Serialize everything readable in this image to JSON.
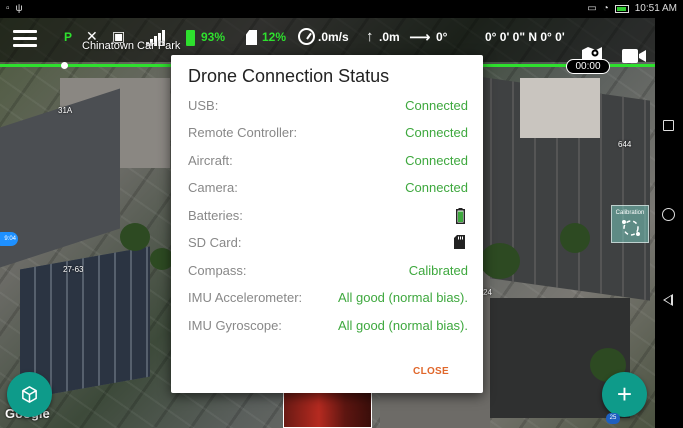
{
  "statusbar": {
    "time": "10:51 AM"
  },
  "topbar": {
    "flight_mode": "P",
    "battery_pct": "93%",
    "sd_pct": "12%",
    "speed": ".0m/s",
    "altitude": ".0m",
    "heading": "0°",
    "coords": "0° 0' 0\" N 0° 0'",
    "location": "Chinatown Car Park"
  },
  "timer": "00:00",
  "map": {
    "labels": [
      "31A",
      "644",
      "27-63",
      "24"
    ],
    "logo": "Google",
    "side_tag": "9:04",
    "scale_tag": "25"
  },
  "calibration_label": "Calibration",
  "dialog": {
    "title": "Drone Connection Status",
    "rows": [
      {
        "label": "USB:",
        "value": "Connected"
      },
      {
        "label": "Remote Controller:",
        "value": "Connected"
      },
      {
        "label": "Aircraft:",
        "value": "Connected"
      },
      {
        "label": "Camera:",
        "value": "Connected"
      },
      {
        "label": "Batteries:",
        "value": "",
        "icon": "battery-icon"
      },
      {
        "label": "SD Card:",
        "value": "",
        "icon": "sd-card-icon"
      },
      {
        "label": "Compass:",
        "value": "Calibrated"
      },
      {
        "label": "IMU Accelerometer:",
        "value": "All good (normal bias)."
      },
      {
        "label": "IMU Gyroscope:",
        "value": "All good (normal bias)."
      }
    ],
    "close_label": "CLOSE"
  },
  "colors": {
    "accent": "#2ee02e",
    "status_ok": "#3ea83e",
    "close": "#e0672b",
    "fab": "#0e9b8a"
  }
}
